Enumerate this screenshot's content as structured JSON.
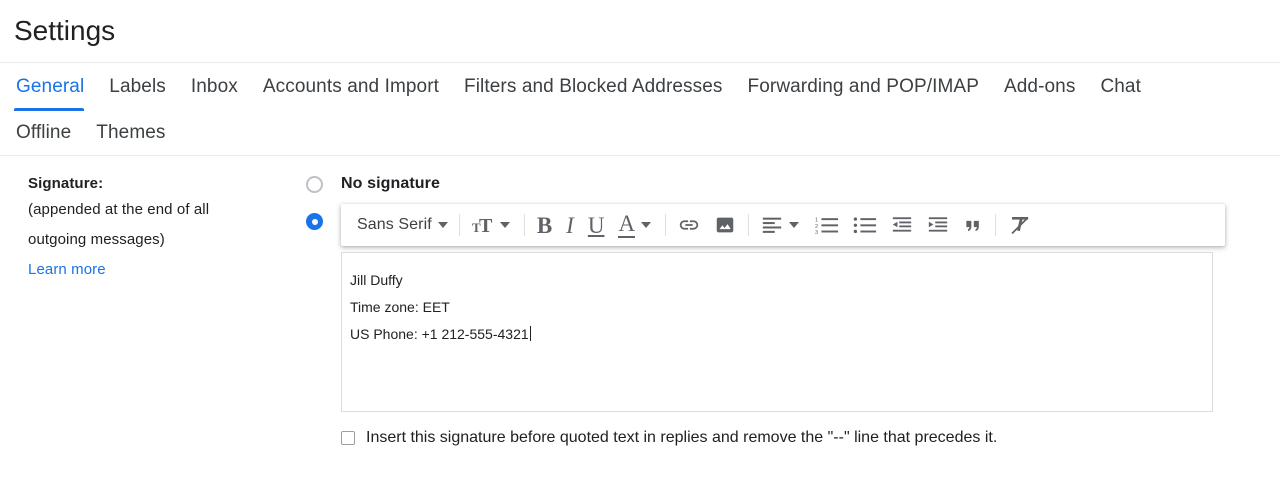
{
  "header": {
    "title": "Settings"
  },
  "tabs": {
    "row1": [
      {
        "label": "General",
        "active": true
      },
      {
        "label": "Labels",
        "active": false
      },
      {
        "label": "Inbox",
        "active": false
      },
      {
        "label": "Accounts and Import",
        "active": false
      },
      {
        "label": "Filters and Blocked Addresses",
        "active": false
      },
      {
        "label": "Forwarding and POP/IMAP",
        "active": false
      },
      {
        "label": "Add-ons",
        "active": false
      },
      {
        "label": "Chat",
        "active": false
      }
    ],
    "row2": [
      {
        "label": "Offline",
        "active": false
      },
      {
        "label": "Themes",
        "active": false
      }
    ]
  },
  "signature_setting": {
    "label_title": "Signature:",
    "label_sub_line1": "(appended at the end of all",
    "label_sub_line2": "outgoing messages)",
    "learn_more": "Learn more",
    "no_signature_label": "No signature",
    "no_signature_selected": false,
    "custom_signature_selected": true,
    "insert_before_quoted_label": "Insert this signature before quoted text in replies and remove the \"--\" line that precedes it.",
    "insert_before_quoted_checked": false
  },
  "editor": {
    "font_name": "Sans Serif",
    "toolbar": [
      {
        "name": "font-family-dropdown",
        "type": "text-dropdown",
        "label": "Sans Serif"
      },
      {
        "name": "font-size-dropdown",
        "type": "icon-dropdown",
        "icon": "format-size-icon"
      },
      {
        "name": "bold-button",
        "type": "glyph",
        "icon": "bold-icon",
        "glyph": "B"
      },
      {
        "name": "italic-button",
        "type": "glyph",
        "icon": "italic-icon",
        "glyph": "I"
      },
      {
        "name": "underline-button",
        "type": "glyph",
        "icon": "underline-icon",
        "glyph": "U"
      },
      {
        "name": "text-color-dropdown",
        "type": "glyph-dropdown",
        "icon": "text-color-icon",
        "glyph": "A"
      },
      {
        "name": "insert-link-button",
        "type": "svg",
        "icon": "link-icon"
      },
      {
        "name": "insert-image-button",
        "type": "svg",
        "icon": "image-icon"
      },
      {
        "name": "align-dropdown",
        "type": "svg-dropdown",
        "icon": "align-left-icon"
      },
      {
        "name": "numbered-list-button",
        "type": "svg",
        "icon": "numbered-list-icon"
      },
      {
        "name": "bulleted-list-button",
        "type": "svg",
        "icon": "bulleted-list-icon"
      },
      {
        "name": "indent-less-button",
        "type": "svg",
        "icon": "indent-less-icon"
      },
      {
        "name": "indent-more-button",
        "type": "svg",
        "icon": "indent-more-icon"
      },
      {
        "name": "quote-button",
        "type": "svg",
        "icon": "quote-icon"
      },
      {
        "name": "remove-formatting-button",
        "type": "svg",
        "icon": "remove-formatting-icon"
      }
    ],
    "signature_text": {
      "line1": "Jill Duffy",
      "line2": "Time zone: EET",
      "line3": "US Phone: +1 212-555-4321"
    }
  },
  "colors": {
    "accent": "#1a73e8",
    "text": "#202124",
    "tab_text": "#3c4043",
    "icon": "#5f6368",
    "border": "#dadce0",
    "divider": "#e8eaed"
  }
}
